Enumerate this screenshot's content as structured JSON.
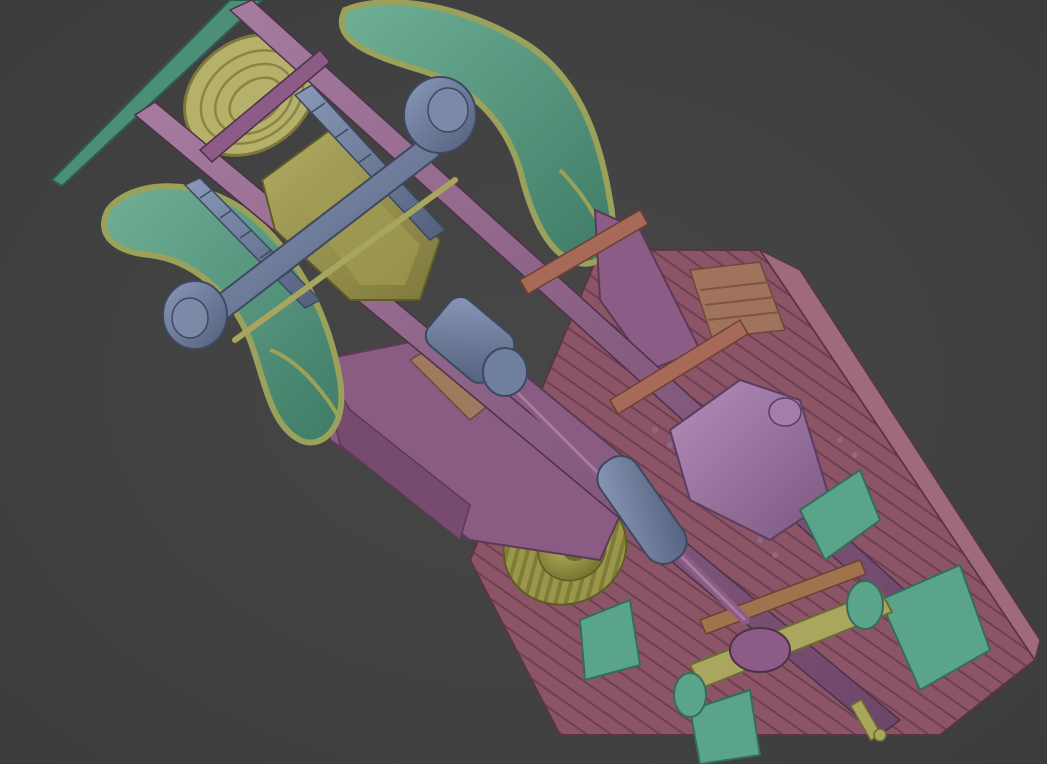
{
  "viewport": {
    "background_color": "#434343",
    "subject": "3d-model-truck-underside"
  },
  "palette": {
    "frame": "#8c5c86",
    "frame_dark": "#6c4568",
    "frame_light": "#a67ba0",
    "fender": "#4c8f78",
    "fender_light": "#6fb096",
    "fender_rim": "#9aa15a",
    "blue_parts": "#6f7f9e",
    "blue_dark": "#525f7c",
    "tank": "#a09a52",
    "tank_dark": "#7d783c",
    "tire": "#a6a24f",
    "tire_dark": "#7f7c37",
    "bed": "#8b5567",
    "bed_slat": "#9a6276",
    "crate": "#a0735c",
    "orange_part": "#a86a58",
    "mudflap": "#5aa58a",
    "canister": "#8a6690",
    "canister_light": "#a27ea8"
  }
}
